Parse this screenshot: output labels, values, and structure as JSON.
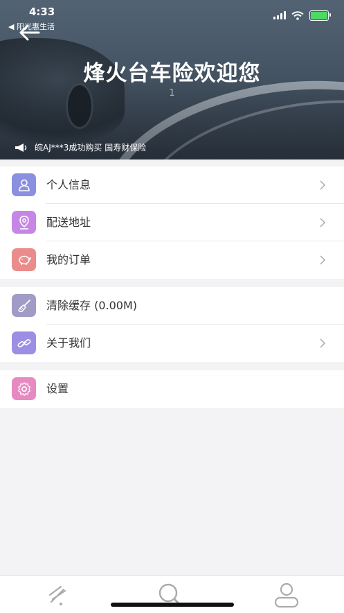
{
  "status_bar": {
    "time": "4:33",
    "back_app": "◀ 阳光惠生活"
  },
  "header": {
    "title": "烽火台车险欢迎您",
    "slide_index": "1",
    "notice": "皖AJ***3成功购买 国寿财保险"
  },
  "menu_groups": [
    [
      {
        "label": "个人信息",
        "icon": "person-icon",
        "color": "#8b8fe0",
        "chevron": true
      },
      {
        "label": "配送地址",
        "icon": "location-pin-icon",
        "color": "#c586e6",
        "chevron": true
      },
      {
        "label": "我的订单",
        "icon": "piggy-bank-icon",
        "color": "#ea8c8c",
        "chevron": true
      }
    ],
    [
      {
        "label": "清除缓存 (0.00M)",
        "icon": "brush-icon",
        "color": "#a09cc6",
        "chevron": false
      },
      {
        "label": "关于我们",
        "icon": "link-icon",
        "color": "#9c8fe3",
        "chevron": true
      }
    ],
    [
      {
        "label": "设置",
        "icon": "gear-icon",
        "color": "#e78ac2",
        "chevron": false
      }
    ]
  ],
  "tab_bar": {
    "items": [
      {
        "icon": "feather-icon"
      },
      {
        "icon": "search-icon"
      },
      {
        "icon": "user-icon"
      }
    ]
  }
}
